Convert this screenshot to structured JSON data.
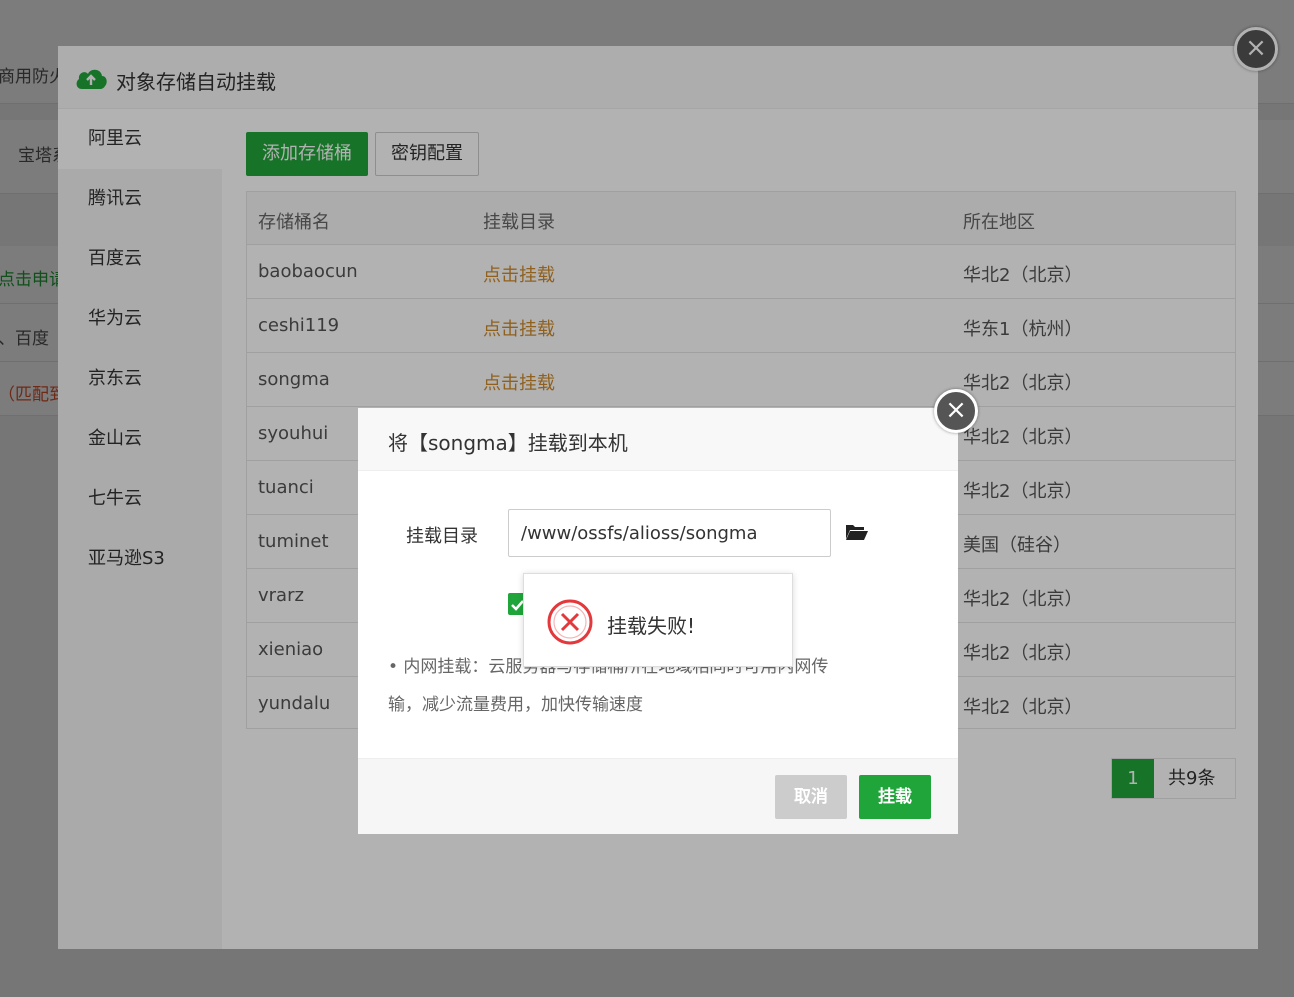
{
  "background": {
    "rows": [
      "商用防火",
      "宝塔系",
      "点击申请",
      "、百度",
      "（匹配到"
    ],
    "colors": {
      "link_green": "#20a53a",
      "orange": "#e4572e"
    }
  },
  "main_modal": {
    "title": "对象存储自动挂载",
    "close_symbol": "×",
    "sidebar": [
      "阿里云",
      "腾讯云",
      "百度云",
      "华为云",
      "京东云",
      "金山云",
      "七牛云",
      "亚马逊S3"
    ],
    "toolbar": {
      "add_bucket": "添加存储桶",
      "key_config": "密钥配置"
    },
    "table": {
      "headers": [
        "存储桶名",
        "挂载目录",
        "所在地区"
      ],
      "rows": [
        {
          "name": "baobaocun",
          "action": "点击挂载",
          "region": "华北2（北京）"
        },
        {
          "name": "ceshi119",
          "action": "点击挂载",
          "region": "华东1（杭州）"
        },
        {
          "name": "songma",
          "action": "点击挂载",
          "region": "华北2（北京）"
        },
        {
          "name": "syouhui",
          "action": "",
          "region": "华北2（北京）"
        },
        {
          "name": "tuanci",
          "action": "",
          "region": "华北2（北京）"
        },
        {
          "name": "tuminet",
          "action": "",
          "region": "美国（硅谷）"
        },
        {
          "name": "vrarz",
          "action": "",
          "region": "华北2（北京）"
        },
        {
          "name": "xieniao",
          "action": "",
          "region": "华北2（北京）"
        },
        {
          "name": "yundalu",
          "action": "",
          "region": "华北2（北京）"
        }
      ]
    },
    "pager": {
      "current": "1",
      "total": "共9条"
    }
  },
  "mount_dialog": {
    "title": "将【songma】挂载到本机",
    "close_symbol": "×",
    "dir_label": "挂载目录",
    "dir_value": "/www/ossfs/alioss/songma",
    "tip_line1": "• 内网挂载：云服务器与存储桶所在地域相同时可用内网传",
    "tip_line2": "输，减少流量费用，加快传输速度",
    "cancel": "取消",
    "mount": "挂载"
  },
  "toast": {
    "message": "挂载失败!",
    "icon": "error-icon"
  }
}
